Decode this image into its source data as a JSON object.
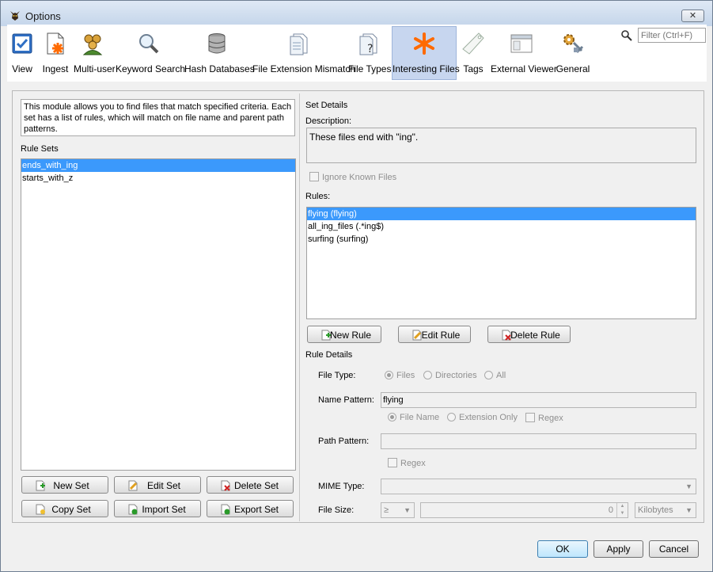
{
  "window": {
    "title": "Options",
    "close": "✕"
  },
  "toolbar": {
    "items": [
      {
        "label": "View",
        "icon": "view-icon"
      },
      {
        "label": "Ingest",
        "icon": "ingest-icon"
      },
      {
        "label": "Multi-user",
        "icon": "multi-user-icon"
      },
      {
        "label": "Keyword Search",
        "icon": "magnifier-icon"
      },
      {
        "label": "Hash Databases",
        "icon": "database-icon"
      },
      {
        "label": "File Extension Mismatch",
        "icon": "document-icon"
      },
      {
        "label": "File Types",
        "icon": "document-question-icon"
      },
      {
        "label": "Interesting Files",
        "icon": "asterisk-icon",
        "selected": true
      },
      {
        "label": "Tags",
        "icon": "tag-icon"
      },
      {
        "label": "External Viewer",
        "icon": "window-icon"
      },
      {
        "label": "General",
        "icon": "gears-icon"
      }
    ],
    "filter_placeholder": "Filter (Ctrl+F)"
  },
  "left": {
    "description": "This module allows you to find files that match specified criteria. Each set has a list of rules, which will match on file name and parent path patterns.",
    "rule_sets_label": "Rule Sets",
    "rule_sets": [
      "ends_with_ing",
      "starts_with_z"
    ],
    "buttons": {
      "new_set": "New Set",
      "edit_set": "Edit Set",
      "delete_set": "Delete Set",
      "copy_set": "Copy Set",
      "import_set": "Import Set",
      "export_set": "Export Set"
    }
  },
  "right": {
    "set_details_label": "Set Details",
    "description_label": "Description:",
    "description_value": "These files end with \"ing\".",
    "ignore_known_label": "Ignore Known Files",
    "rules_label": "Rules:",
    "rules": [
      "flying (flying)",
      "all_ing_files (.*ing$)",
      "surfing (surfing)"
    ],
    "buttons": {
      "new_rule": "New Rule",
      "edit_rule": "Edit Rule",
      "delete_rule": "Delete Rule"
    },
    "rule_details_label": "Rule Details",
    "file_type_label": "File Type:",
    "file_type_options": [
      "Files",
      "Directories",
      "All"
    ],
    "name_pattern_label": "Name Pattern:",
    "name_pattern_value": "flying",
    "name_options": [
      "File Name",
      "Extension Only"
    ],
    "regex_label": "Regex",
    "path_pattern_label": "Path Pattern:",
    "path_pattern_value": "",
    "path_regex_label": "Regex",
    "mime_type_label": "MIME Type:",
    "mime_type_value": "",
    "file_size_label": "File Size:",
    "file_size_op": "≥",
    "file_size_value": "0",
    "file_size_unit": "Kilobytes"
  },
  "dialog_buttons": {
    "ok": "OK",
    "apply": "Apply",
    "cancel": "Cancel"
  },
  "colors": {
    "selection": "#3b99fc",
    "selected_tab": "#c7d6ef",
    "accent": "#ff6a00"
  }
}
